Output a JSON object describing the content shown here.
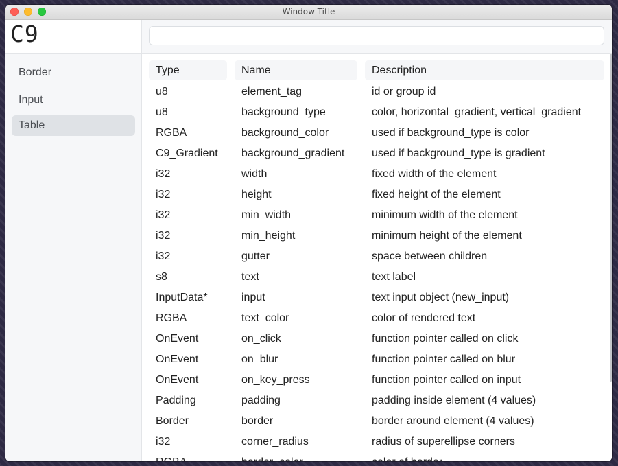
{
  "window": {
    "title": "Window Title"
  },
  "logo": {
    "text": "C9"
  },
  "sidebar": {
    "items": [
      {
        "label": "Border"
      },
      {
        "label": "Input"
      },
      {
        "label": "Table"
      }
    ],
    "active": "Table"
  },
  "search": {
    "value": "",
    "placeholder": ""
  },
  "table": {
    "headers": [
      "Type",
      "Name",
      "Description"
    ],
    "rows": [
      [
        "u8",
        "element_tag",
        "id or group id"
      ],
      [
        "u8",
        "background_type",
        "color, horizontal_gradient, vertical_gradient"
      ],
      [
        "RGBA",
        "background_color",
        "used if background_type is color"
      ],
      [
        "C9_Gradient",
        "background_gradient",
        "used if background_type is gradient"
      ],
      [
        "i32",
        "width",
        "fixed width of the element"
      ],
      [
        "i32",
        "height",
        "fixed height of the element"
      ],
      [
        "i32",
        "min_width",
        "minimum width of the element"
      ],
      [
        "i32",
        "min_height",
        "minimum height of the element"
      ],
      [
        "i32",
        "gutter",
        "space between children"
      ],
      [
        "s8",
        "text",
        "text label"
      ],
      [
        "InputData*",
        "input",
        "text input object (new_input)"
      ],
      [
        "RGBA",
        "text_color",
        "color of rendered text"
      ],
      [
        "OnEvent",
        "on_click",
        "function pointer called on click"
      ],
      [
        "OnEvent",
        "on_blur",
        "function pointer called on blur"
      ],
      [
        "OnEvent",
        "on_key_press",
        "function pointer called on input"
      ],
      [
        "Padding",
        "padding",
        "padding inside element (4 values)"
      ],
      [
        "Border",
        "border",
        "border around element (4 values)"
      ],
      [
        "i32",
        "corner_radius",
        "radius of superellipse corners"
      ],
      [
        "RGBA",
        "border_color",
        "color of border"
      ]
    ]
  },
  "colors": {
    "traffic_close": "#fe5f57",
    "traffic_minimize": "#febc2e",
    "traffic_zoom": "#28c840",
    "sidebar_active": "#dfe2e6"
  }
}
